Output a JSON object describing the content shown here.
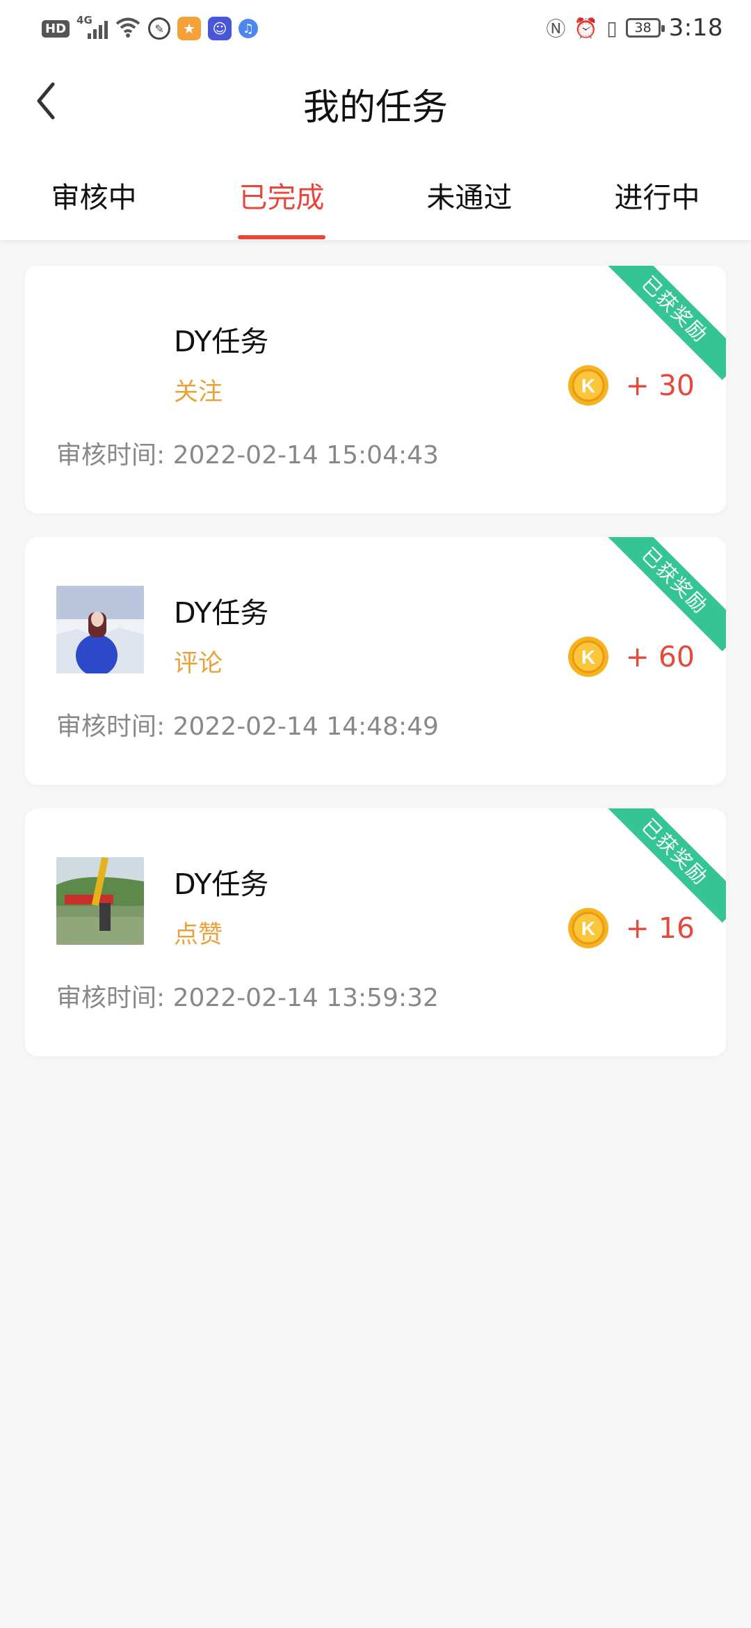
{
  "status_bar": {
    "left_badge": "HD",
    "network": "4G",
    "battery": "38",
    "time": "3:18"
  },
  "header": {
    "title": "我的任务"
  },
  "tabs": [
    {
      "label": "审核中"
    },
    {
      "label": "已完成"
    },
    {
      "label": "未通过"
    },
    {
      "label": "进行中"
    }
  ],
  "active_tab": 1,
  "tasks": [
    {
      "title": "DY任务",
      "type": "关注",
      "reward": "+ 30",
      "badge": "已获奖励",
      "time": "审核时间: 2022-02-14 15:04:43",
      "thumbnail": "none"
    },
    {
      "title": "DY任务",
      "type": "评论",
      "reward": "+ 60",
      "badge": "已获奖励",
      "time": "审核时间: 2022-02-14 14:48:49",
      "thumbnail": "woman-in-snow"
    },
    {
      "title": "DY任务",
      "type": "点赞",
      "reward": "+ 16",
      "badge": "已获奖励",
      "time": "审核时间: 2022-02-14 13:59:32",
      "thumbnail": "excavator-by-pond"
    }
  ],
  "colors": {
    "accent": "#e8483c",
    "task_type": "#e9a23b",
    "reward": "#e34a3c",
    "ribbon": "#35c494",
    "coin": "#f6b21f"
  },
  "icons": {
    "back": "chevron-left-icon",
    "coin": "k-coin-icon"
  }
}
